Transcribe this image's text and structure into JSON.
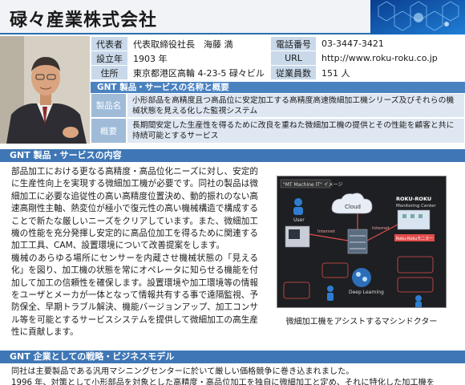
{
  "company": {
    "name": "碌々産業株式会社"
  },
  "info": {
    "rep_label": "代表者",
    "rep_value": "代表取締役社長　海藤 満",
    "phone_label": "電話番号",
    "phone_value": "03-3447-3421",
    "founded_label": "設立年",
    "founded_value": "1903 年",
    "url_label": "URL",
    "url_value": "http://www.roku-roku.co.jp",
    "address_label": "住所",
    "address_value": "東京都港区高輪 4-23-5 碌々ビル",
    "employees_label": "従業員数",
    "employees_value": "151 人"
  },
  "product_summary": {
    "title": "GNT 製品・サービスの名称と概要",
    "name_label": "製品名",
    "name_value": "小形部品を高精度且つ高品位に安定加工する高精度高速微細加工機シリーズ及びそれらの機械状態を見える化した監視システム",
    "overview_label": "概要",
    "overview_value": "長期間安定した生産性を得るために改良を重ねた微細加工機の提供とその性能を顧客と共に持続可能とするサービス"
  },
  "content_section": {
    "title": "GNT 製品・サービスの内容",
    "para1": "部品加工における更なる高精度・高品位化ニーズに対し、安定的に生産性向上を実現する微細加工機が必要です。同社の製品は微細加工に必要な追従性の高い高精度位置決め、動的振れのない高速高剛性主軸、熱変位が極小で復元性の高い機械構造で構成することで新たな厳しいニーズをクリアしています。また、微細加工機の性能を充分発揮し安定的に高品位加工を得るために関連する加工工具、CAM、設置環境について改善提案をします。",
    "para2": "機械のあらゆる場所にセンサーを内蔵させ機械状態の「見える化」を図り、加工機の状態を常にオペレータに知らせる機能を付加して加工の信頼性を確保します。設置環境や加工環境等の情報をユーザとメーカが一体となって情報共有する事で遠隔監視、予防保全、早期トラブル解決、機能バージョンアップ、加工コンサル等を可能とするサービスシステムを提供して微細加工の高生産性に貢献します。",
    "image": {
      "title": "\"MT Machine IT\" イメージ",
      "cloud": "Cloud",
      "user": "User",
      "internet": "Internet",
      "center_title": "ROKU-ROKU",
      "center_sub": "Monitoring Center",
      "monitor": "Roku-Rokuモニター",
      "deep_learning": "Deep Learning"
    },
    "caption": "微細加工機をアシストするマシンドクター"
  },
  "strategy_section": {
    "title": "GNT 企業としての戦略・ビジネスモデル",
    "line1": "同社は主要製品である汎用マシニングセンターに於いて厳しい価格競争に巻き込まれました。",
    "line2": "1996 年、対策として小形部品を対象とした高精度・高品位加工を独自に微細加工と定め、それに特化した加工機を"
  }
}
